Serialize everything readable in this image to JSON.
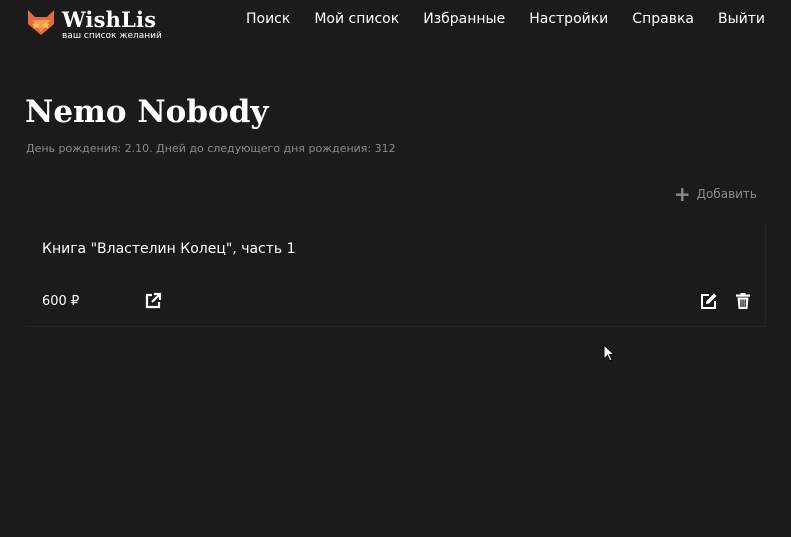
{
  "header": {
    "logo_title": "WishLis",
    "logo_tagline": "ваш список желаний",
    "logo_icon": "fox-logo-icon",
    "nav": [
      {
        "label": "Поиск"
      },
      {
        "label": "Мой список"
      },
      {
        "label": "Избранные"
      },
      {
        "label": "Настройки"
      },
      {
        "label": "Справка"
      },
      {
        "label": "Выйти"
      }
    ]
  },
  "profile": {
    "name": "Nemo Nobody",
    "birthday_info": "День рождения: 2.10. Дней до следующего дня рождения: 312"
  },
  "actions": {
    "add_label": "Добавить",
    "add_icon": "plus-icon"
  },
  "wishes": [
    {
      "title": "Книга \"Властелин Колец\", часть 1",
      "price": "600 ₽",
      "link_icon": "external-link-icon",
      "edit_icon": "edit-icon",
      "delete_icon": "trash-icon"
    }
  ],
  "colors": {
    "background": "#1c1b1b",
    "text": "#ffffff",
    "muted": "#8a8a8a",
    "logo_orange": "#e8693a",
    "logo_yellow": "#f5c242"
  }
}
